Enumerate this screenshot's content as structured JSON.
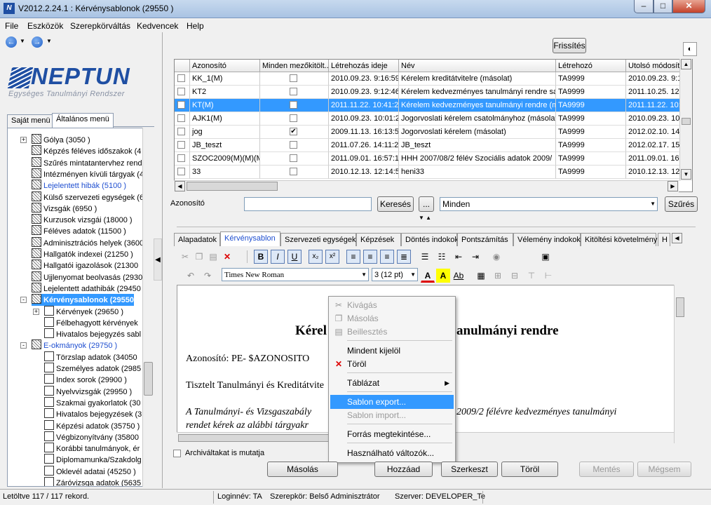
{
  "window": {
    "title": "V2012.2.24.1 : Kérvénysablonok (29550 )",
    "app_icon": "N"
  },
  "menu": [
    "File",
    "Eszközök",
    "Szerepkörváltás",
    "Kedvencek",
    "Help"
  ],
  "logo": {
    "name": "NEPTUN",
    "subtitle": "Egységes Tanulmányi Rendszer"
  },
  "left_tabs": [
    "Saját menü",
    "Általános menü"
  ],
  "tree": [
    {
      "label": "Gólya (3050  )",
      "level": 1,
      "expander": "+"
    },
    {
      "label": "Képzés féléves időszakok (4",
      "level": 1
    },
    {
      "label": "Szűrés mintatantervhez rende",
      "level": 1
    },
    {
      "label": "Intézményen kívüli tárgyak (4",
      "level": 1
    },
    {
      "label": "Lejelentett hibák (5100  )",
      "level": 1,
      "style": "blue"
    },
    {
      "label": "Külső szervezeti egységek (6",
      "level": 1
    },
    {
      "label": "Vizsgák (6950  )",
      "level": 1
    },
    {
      "label": "Kurzusok vizsgái (18000  )",
      "level": 1
    },
    {
      "label": "Féléves adatok (11500  )",
      "level": 1
    },
    {
      "label": "Adminisztrációs helyek (3600",
      "level": 1
    },
    {
      "label": "Hallgatók indexei (21250  )",
      "level": 1
    },
    {
      "label": "Hallgatói igazolások (21300",
      "level": 1
    },
    {
      "label": "Ujjlenyomat beolvasás (2930",
      "level": 1
    },
    {
      "label": "Lejelentett adathibák (29450",
      "level": 1
    },
    {
      "label": "Kérvénysablonok (29550",
      "level": 1,
      "expander": "-",
      "style": "sel"
    },
    {
      "label": "Kérvények (29650  )",
      "level": 2,
      "expander": "+"
    },
    {
      "label": "Félbehagyott kérvények",
      "level": 2
    },
    {
      "label": "Hivatalos bejegyzés sabl",
      "level": 2
    },
    {
      "label": "E-okmányok (29750  )",
      "level": 1,
      "expander": "-",
      "style": "blue"
    },
    {
      "label": "Törzslap adatok (34050",
      "level": 2
    },
    {
      "label": "Személyes adatok (2985",
      "level": 2
    },
    {
      "label": "Index sorok (29900  )",
      "level": 2
    },
    {
      "label": "Nyelvvizsgák (29950  )",
      "level": 2
    },
    {
      "label": "Szakmai gyakorlatok (30",
      "level": 2
    },
    {
      "label": "Hivatalos bejegyzések (3",
      "level": 2
    },
    {
      "label": "Képzési adatok (35750  )",
      "level": 2
    },
    {
      "label": "Végbizonyítvány (35800",
      "level": 2
    },
    {
      "label": "Korábbi tanulmányok, ér",
      "level": 2
    },
    {
      "label": "Diplomamunka/Szakdolg",
      "level": 2
    },
    {
      "label": "Oklevél adatai (45250  )",
      "level": 2
    },
    {
      "label": "Záróvizsga adatok (5635",
      "level": 2
    }
  ],
  "refresh_button": "Frissítés",
  "grid": {
    "columns": [
      "",
      "Azonosító",
      "Minden mezőkitölt...",
      "Létrehozás ideje",
      "Név",
      "Létrehozó",
      "Utolsó módosítá"
    ],
    "rows": [
      {
        "id": "KK_1(M)",
        "all": false,
        "created": "2010.09.23. 9:16:59",
        "name": "Kérelem kreditátvitelre (másolat)",
        "creator": "TA9999",
        "modified": "2010.09.23. 9:1"
      },
      {
        "id": "KT2",
        "all": false,
        "created": "2010.09.23. 9:12:46",
        "name": "Kérelem kedvezményes tanulmányi rendre sab",
        "creator": "TA9999",
        "modified": "2011.10.25. 12:"
      },
      {
        "id": "KT(M)",
        "all": false,
        "created": "2011.11.22. 10:41:2",
        "name": "Kérelem kedvezményes tanulmányi rendre (má",
        "creator": "TA9999",
        "modified": "2011.11.22. 10:",
        "selected": true
      },
      {
        "id": "AJK1(M)",
        "all": false,
        "created": "2010.09.23. 10:01:2",
        "name": "Jogorvoslati kérelem csatolmányhoz (másolat)",
        "creator": "TA9999",
        "modified": "2010.09.23. 10:"
      },
      {
        "id": "jog",
        "all": true,
        "created": "2009.11.13. 16:13:5",
        "name": "Jogorvoslati kérelem (másolat)",
        "creator": "TA9999",
        "modified": "2012.02.10. 14:"
      },
      {
        "id": "JB_teszt",
        "all": false,
        "created": "2011.07.26. 14:11:2",
        "name": "JB_teszt",
        "creator": "TA9999",
        "modified": "2012.02.17. 15:"
      },
      {
        "id": "SZOC2009(M)(M)(M",
        "all": false,
        "created": "2011.09.01. 16:57:1",
        "name": "HHH 2007/08/2 félév Szociális adatok 2009/",
        "creator": "TA9999",
        "modified": "2011.09.01. 16:"
      },
      {
        "id": "33",
        "all": false,
        "created": "2010.12.13. 12:14:5",
        "name": "heni33",
        "creator": "TA9999",
        "modified": "2010.12.13. 12:"
      }
    ]
  },
  "filter": {
    "label": "Azonosító",
    "value": "",
    "search_button": "Keresés",
    "dots_button": "...",
    "select_value": "Minden",
    "filter_button": "Szűrés"
  },
  "tabs": [
    "Alapadatok",
    "Kérvénysablon",
    "Szervezeti egységek",
    "Képzések",
    "Döntés indokok",
    "Pontszámítás",
    "Vélemény indokok",
    "Kitöltési követelmény",
    "H"
  ],
  "toolbar": {
    "font": "Times New Roman",
    "size": "3  (12 pt)",
    "bold": "B",
    "italic": "I",
    "underline": "U",
    "color_a": "A",
    "hl_a": "A",
    "ab": "Ab"
  },
  "editor": {
    "heading_left": "Kérel",
    "heading_right": "anulmányi rendre",
    "id_line": "Azonosító: PE-    $AZONOSITO",
    "greeting": "Tisztelt Tanulmányi és Kreditátvite",
    "para1_left": "A Tanulmányi- és Vizsgaszabály",
    "para1_right": "2009/2 félévre kedvezményes tanulmányi",
    "para2_left": "rendet kérek az alábbi tárgyakr"
  },
  "context_menu": [
    {
      "label": "Kivágás",
      "disabled": true,
      "icon": "scissors-icon"
    },
    {
      "label": "Másolás",
      "disabled": true,
      "icon": "copy-icon"
    },
    {
      "label": "Beillesztés",
      "disabled": true,
      "icon": "paste-icon"
    },
    {
      "label": "Mindent kijelöl"
    },
    {
      "label": "Töröl",
      "icon": "delete-icon"
    },
    {
      "label": "Táblázat",
      "submenu": true
    },
    {
      "label": "Sablon export...",
      "highlighted": true
    },
    {
      "label": "Sablon import...",
      "disabled": true
    },
    {
      "label": "Forrás megtekintése..."
    },
    {
      "label": "Használható változók..."
    }
  ],
  "archived_checkbox": "Archiváltakat is mutatja",
  "bottom_buttons": {
    "copy": "Másolás",
    "add": "Hozzáad",
    "edit": "Szerkeszt",
    "delete": "Töröl",
    "save": "Mentés",
    "cancel": "Mégsem"
  },
  "status": {
    "loaded": "Letöltve 117 / 117 rekord.",
    "login": "Loginnév: TA",
    "role": "Szerepkör: Belső Adminisztrátor",
    "server": "Szerver: DEVELOPER_Te"
  },
  "colors": {
    "selection": "#3399ff",
    "brand": "#1f4fa3"
  }
}
